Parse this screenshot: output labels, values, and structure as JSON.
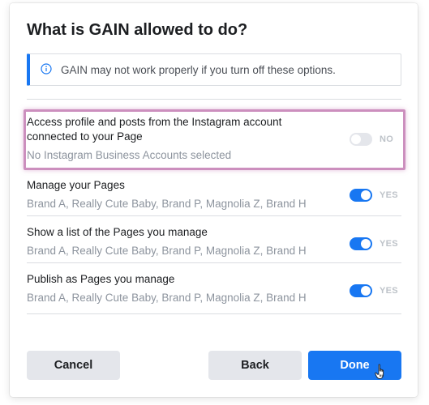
{
  "dialog": {
    "title": "What is GAIN allowed to do?",
    "notice_text": "GAIN may not work properly if you turn off these options.",
    "accent_color": "#1877f2",
    "highlight_color": "#cc8fbe"
  },
  "permissions": [
    {
      "name": "Access profile and posts from the Instagram account connected to your Page",
      "description": "No Instagram Business Accounts selected",
      "enabled": false,
      "state_label": "NO"
    },
    {
      "name": "Manage your Pages",
      "description": "Brand A, Really Cute Baby, Brand P, Magnolia Z, Brand H",
      "enabled": true,
      "state_label": "YES"
    },
    {
      "name": "Show a list of the Pages you manage",
      "description": "Brand A, Really Cute Baby, Brand P, Magnolia Z, Brand H",
      "enabled": true,
      "state_label": "YES"
    },
    {
      "name": "Publish as Pages you manage",
      "description": "Brand A, Really Cute Baby, Brand P, Magnolia Z, Brand H",
      "enabled": true,
      "state_label": "YES"
    }
  ],
  "buttons": {
    "cancel": "Cancel",
    "back": "Back",
    "done": "Done"
  },
  "icons": {
    "notice": "info-icon",
    "cursor": "hand-pointer-icon"
  }
}
